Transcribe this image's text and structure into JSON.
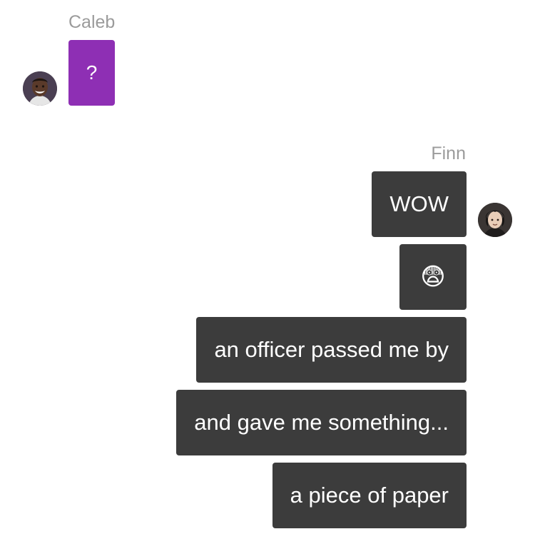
{
  "thread": {
    "incoming": {
      "sender_name": "Caleb",
      "messages": [
        "?"
      ]
    },
    "outgoing": {
      "sender_name": "Finn",
      "messages": [
        "WOW",
        "😨",
        "an officer passed me by",
        "and gave me something...",
        "a piece of paper"
      ]
    }
  },
  "colors": {
    "incoming_bubble": "#8e2fb4",
    "outgoing_bubble": "#3c3c3c",
    "sender_name_text": "#9b9b9b"
  }
}
